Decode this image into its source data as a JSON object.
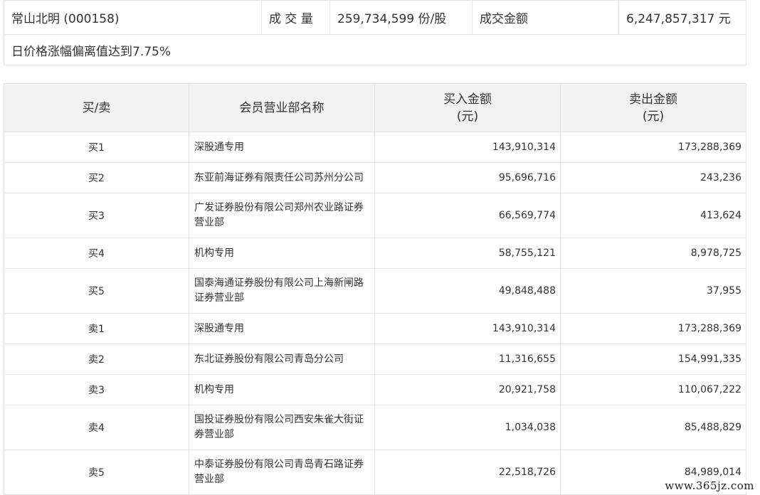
{
  "summary": {
    "stock": "常山北明 (000158)",
    "volume_label": "成 交 量",
    "volume_value": "259,734,599 份/股",
    "amount_label": "成交金额",
    "amount_value": "6,247,857,317 元",
    "reason": "日价格涨幅偏离值达到7.75%"
  },
  "table": {
    "headers": {
      "side": "买/卖",
      "name": "会员营业部名称",
      "buy_amount": "买入金额",
      "buy_unit": "(元)",
      "sell_amount": "卖出金额",
      "sell_unit": "(元)"
    },
    "rows": [
      {
        "side": "买1",
        "name": "深股通专用",
        "buy": "143,910,314",
        "sell": "173,288,369"
      },
      {
        "side": "买2",
        "name": "东亚前海证券有限责任公司苏州分公司",
        "buy": "95,696,716",
        "sell": "243,236"
      },
      {
        "side": "买3",
        "name": "广发证券股份有限公司郑州农业路证券营业部",
        "buy": "66,569,774",
        "sell": "413,624"
      },
      {
        "side": "买4",
        "name": "机构专用",
        "buy": "58,755,121",
        "sell": "8,978,725"
      },
      {
        "side": "买5",
        "name": "国泰海通证券股份有限公司上海新闸路证券营业部",
        "buy": "49,848,488",
        "sell": "37,955"
      },
      {
        "side": "卖1",
        "name": "深股通专用",
        "buy": "143,910,314",
        "sell": "173,288,369"
      },
      {
        "side": "卖2",
        "name": "东北证券股份有限公司青岛分公司",
        "buy": "11,316,655",
        "sell": "154,991,335"
      },
      {
        "side": "卖3",
        "name": "机构专用",
        "buy": "20,921,758",
        "sell": "110,067,222"
      },
      {
        "side": "卖4",
        "name": "国投证券股份有限公司西安朱雀大街证券营业部",
        "buy": "1,034,038",
        "sell": "85,488,829"
      },
      {
        "side": "卖5",
        "name": "中泰证券股份有限公司青岛青石路证券营业部",
        "buy": "22,518,726",
        "sell": "84,989,014"
      }
    ]
  },
  "watermark": "www.365jz.com"
}
